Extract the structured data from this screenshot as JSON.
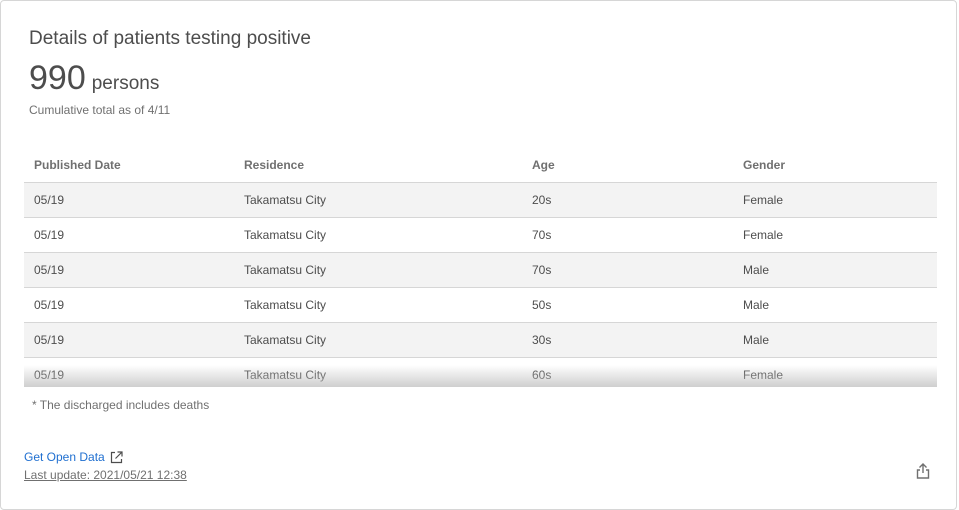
{
  "card": {
    "title": "Details of patients testing positive",
    "total_value": "990",
    "total_unit": "persons",
    "subtitle": "Cumulative total as of 4/11"
  },
  "table": {
    "headers": [
      "Published Date",
      "Residence",
      "Age",
      "Gender"
    ],
    "rows": [
      [
        "05/19",
        "Takamatsu City",
        "20s",
        "Female"
      ],
      [
        "05/19",
        "Takamatsu City",
        "70s",
        "Female"
      ],
      [
        "05/19",
        "Takamatsu City",
        "70s",
        "Male"
      ],
      [
        "05/19",
        "Takamatsu City",
        "50s",
        "Male"
      ],
      [
        "05/19",
        "Takamatsu City",
        "30s",
        "Male"
      ],
      [
        "05/19",
        "Takamatsu City",
        "60s",
        "Female"
      ]
    ]
  },
  "footer": {
    "note": "* The discharged includes deaths",
    "open_data_link": "Get Open Data",
    "last_update": "Last update: 2021/05/21 12:38"
  },
  "icons": {
    "external_link": "external-link-icon",
    "share": "share-icon"
  },
  "colors": {
    "link": "#1f6fd0",
    "stripe": "#f3f3f3"
  }
}
